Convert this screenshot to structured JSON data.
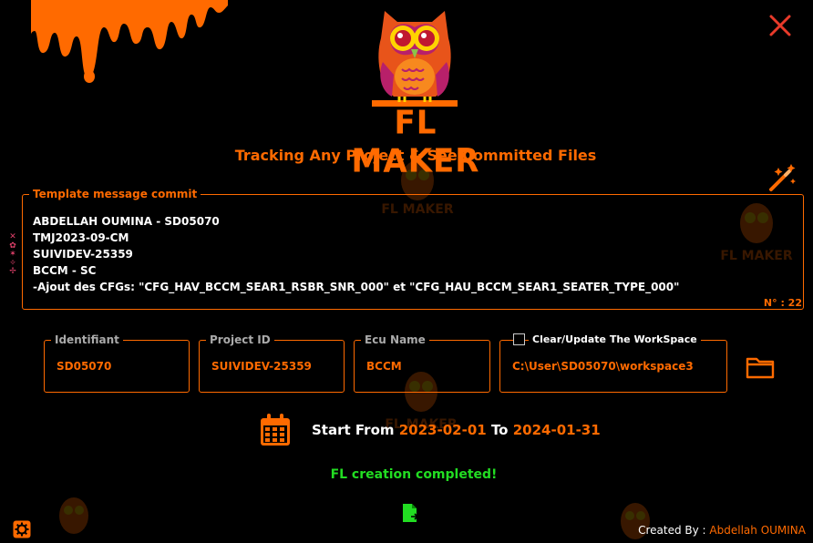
{
  "header": {
    "brand": "FL MAKER",
    "subtitle": "Tracking Any Project & See Committed Files"
  },
  "template": {
    "legend": "Template message commit",
    "lines": [
      "ABDELLAH OUMINA - SD05070",
      "TMJ2023-09-CM",
      "SUIVIDEV-25359",
      "BCCM - SC",
      "-Ajout des CFGs: \"CFG_HAV_BCCM_SEAR1_RSBR_SNR_000\" et \"CFG_HAU_BCCM_SEAR1_SEATER_TYPE_000\""
    ],
    "count": "N° : 22"
  },
  "fields": {
    "identifiant": {
      "label": "Identifiant",
      "value": "SD05070"
    },
    "project_id": {
      "label": "Project ID",
      "value": "SUIVIDEV-25359"
    },
    "ecu_name": {
      "label": "Ecu Name",
      "value": "BCCM"
    },
    "workspace": {
      "label": "Clear/Update The WorkSpace",
      "value": "C:\\User\\SD05070\\workspace3",
      "checked": false
    }
  },
  "dates": {
    "start_label": "Start From",
    "start": "2023-02-01",
    "to_label": "To",
    "end": "2024-01-31"
  },
  "status": "FL creation completed!",
  "footer": {
    "created_by_label": "Created By :",
    "author": "Abdellah OUMINA"
  },
  "colors": {
    "accent": "#ff6a00",
    "success": "#22dd22",
    "close": "#e83a2a",
    "background": "#000000"
  },
  "icons": [
    "close-icon",
    "magic-wand-icon",
    "folder-icon",
    "calendar-icon",
    "file-export-icon",
    "gear-icon",
    "owl-logo"
  ]
}
